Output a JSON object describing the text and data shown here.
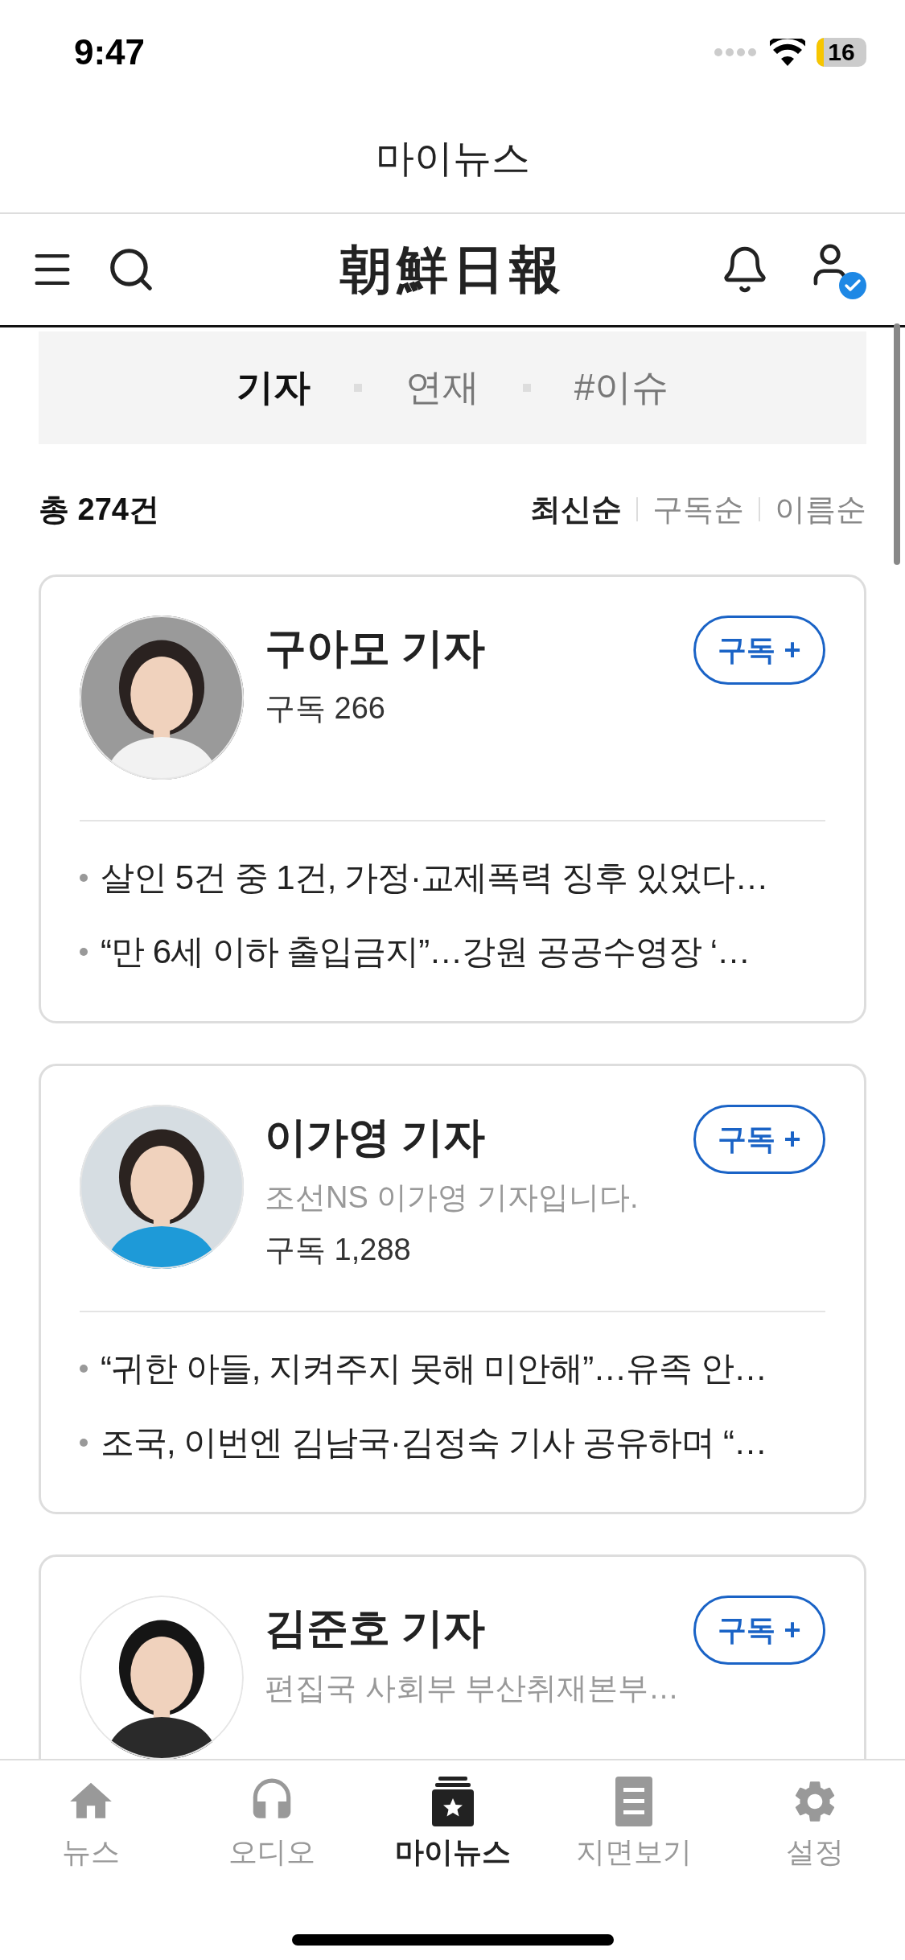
{
  "status_bar": {
    "time": "9:47",
    "battery": "16"
  },
  "title": "마이뉴스",
  "header": {
    "logo": "朝鮮日報"
  },
  "tabs": [
    {
      "label": "기자",
      "selected": true
    },
    {
      "label": "연재",
      "selected": false
    },
    {
      "label": "#이슈",
      "selected": false
    }
  ],
  "summary": {
    "total": "총 274건",
    "sort_options": [
      {
        "label": "최신순",
        "selected": true
      },
      {
        "label": "구독순",
        "selected": false
      },
      {
        "label": "이름순",
        "selected": false
      }
    ]
  },
  "reporters": [
    {
      "name": "구아모 기자",
      "subscribers": "구독 266",
      "subscribe_button": "구독 +",
      "headlines": [
        "살인 5건 중 1건, 가정·교제폭력 징후 있었다…",
        "“만 6세 이하 출입금지”…강원 공공수영장 ‘…"
      ]
    },
    {
      "name": "이가영 기자",
      "bio": "조선NS 이가영 기자입니다.",
      "subscribers": "구독 1,288",
      "subscribe_button": "구독 +",
      "headlines": [
        "“귀한 아들, 지켜주지 못해 미안해”…유족 안…",
        "조국, 이번엔 김남국·김정숙 기사 공유하며 “…"
      ]
    },
    {
      "name": "김준호 기자",
      "bio": "편집국 사회부 부산취재본부…",
      "subscribe_button": "구독 +"
    }
  ],
  "bottom_nav": [
    {
      "label": "뉴스",
      "selected": false
    },
    {
      "label": "오디오",
      "selected": false
    },
    {
      "label": "마이뉴스",
      "selected": true
    },
    {
      "label": "지면보기",
      "selected": false
    },
    {
      "label": "설정",
      "selected": false
    }
  ]
}
